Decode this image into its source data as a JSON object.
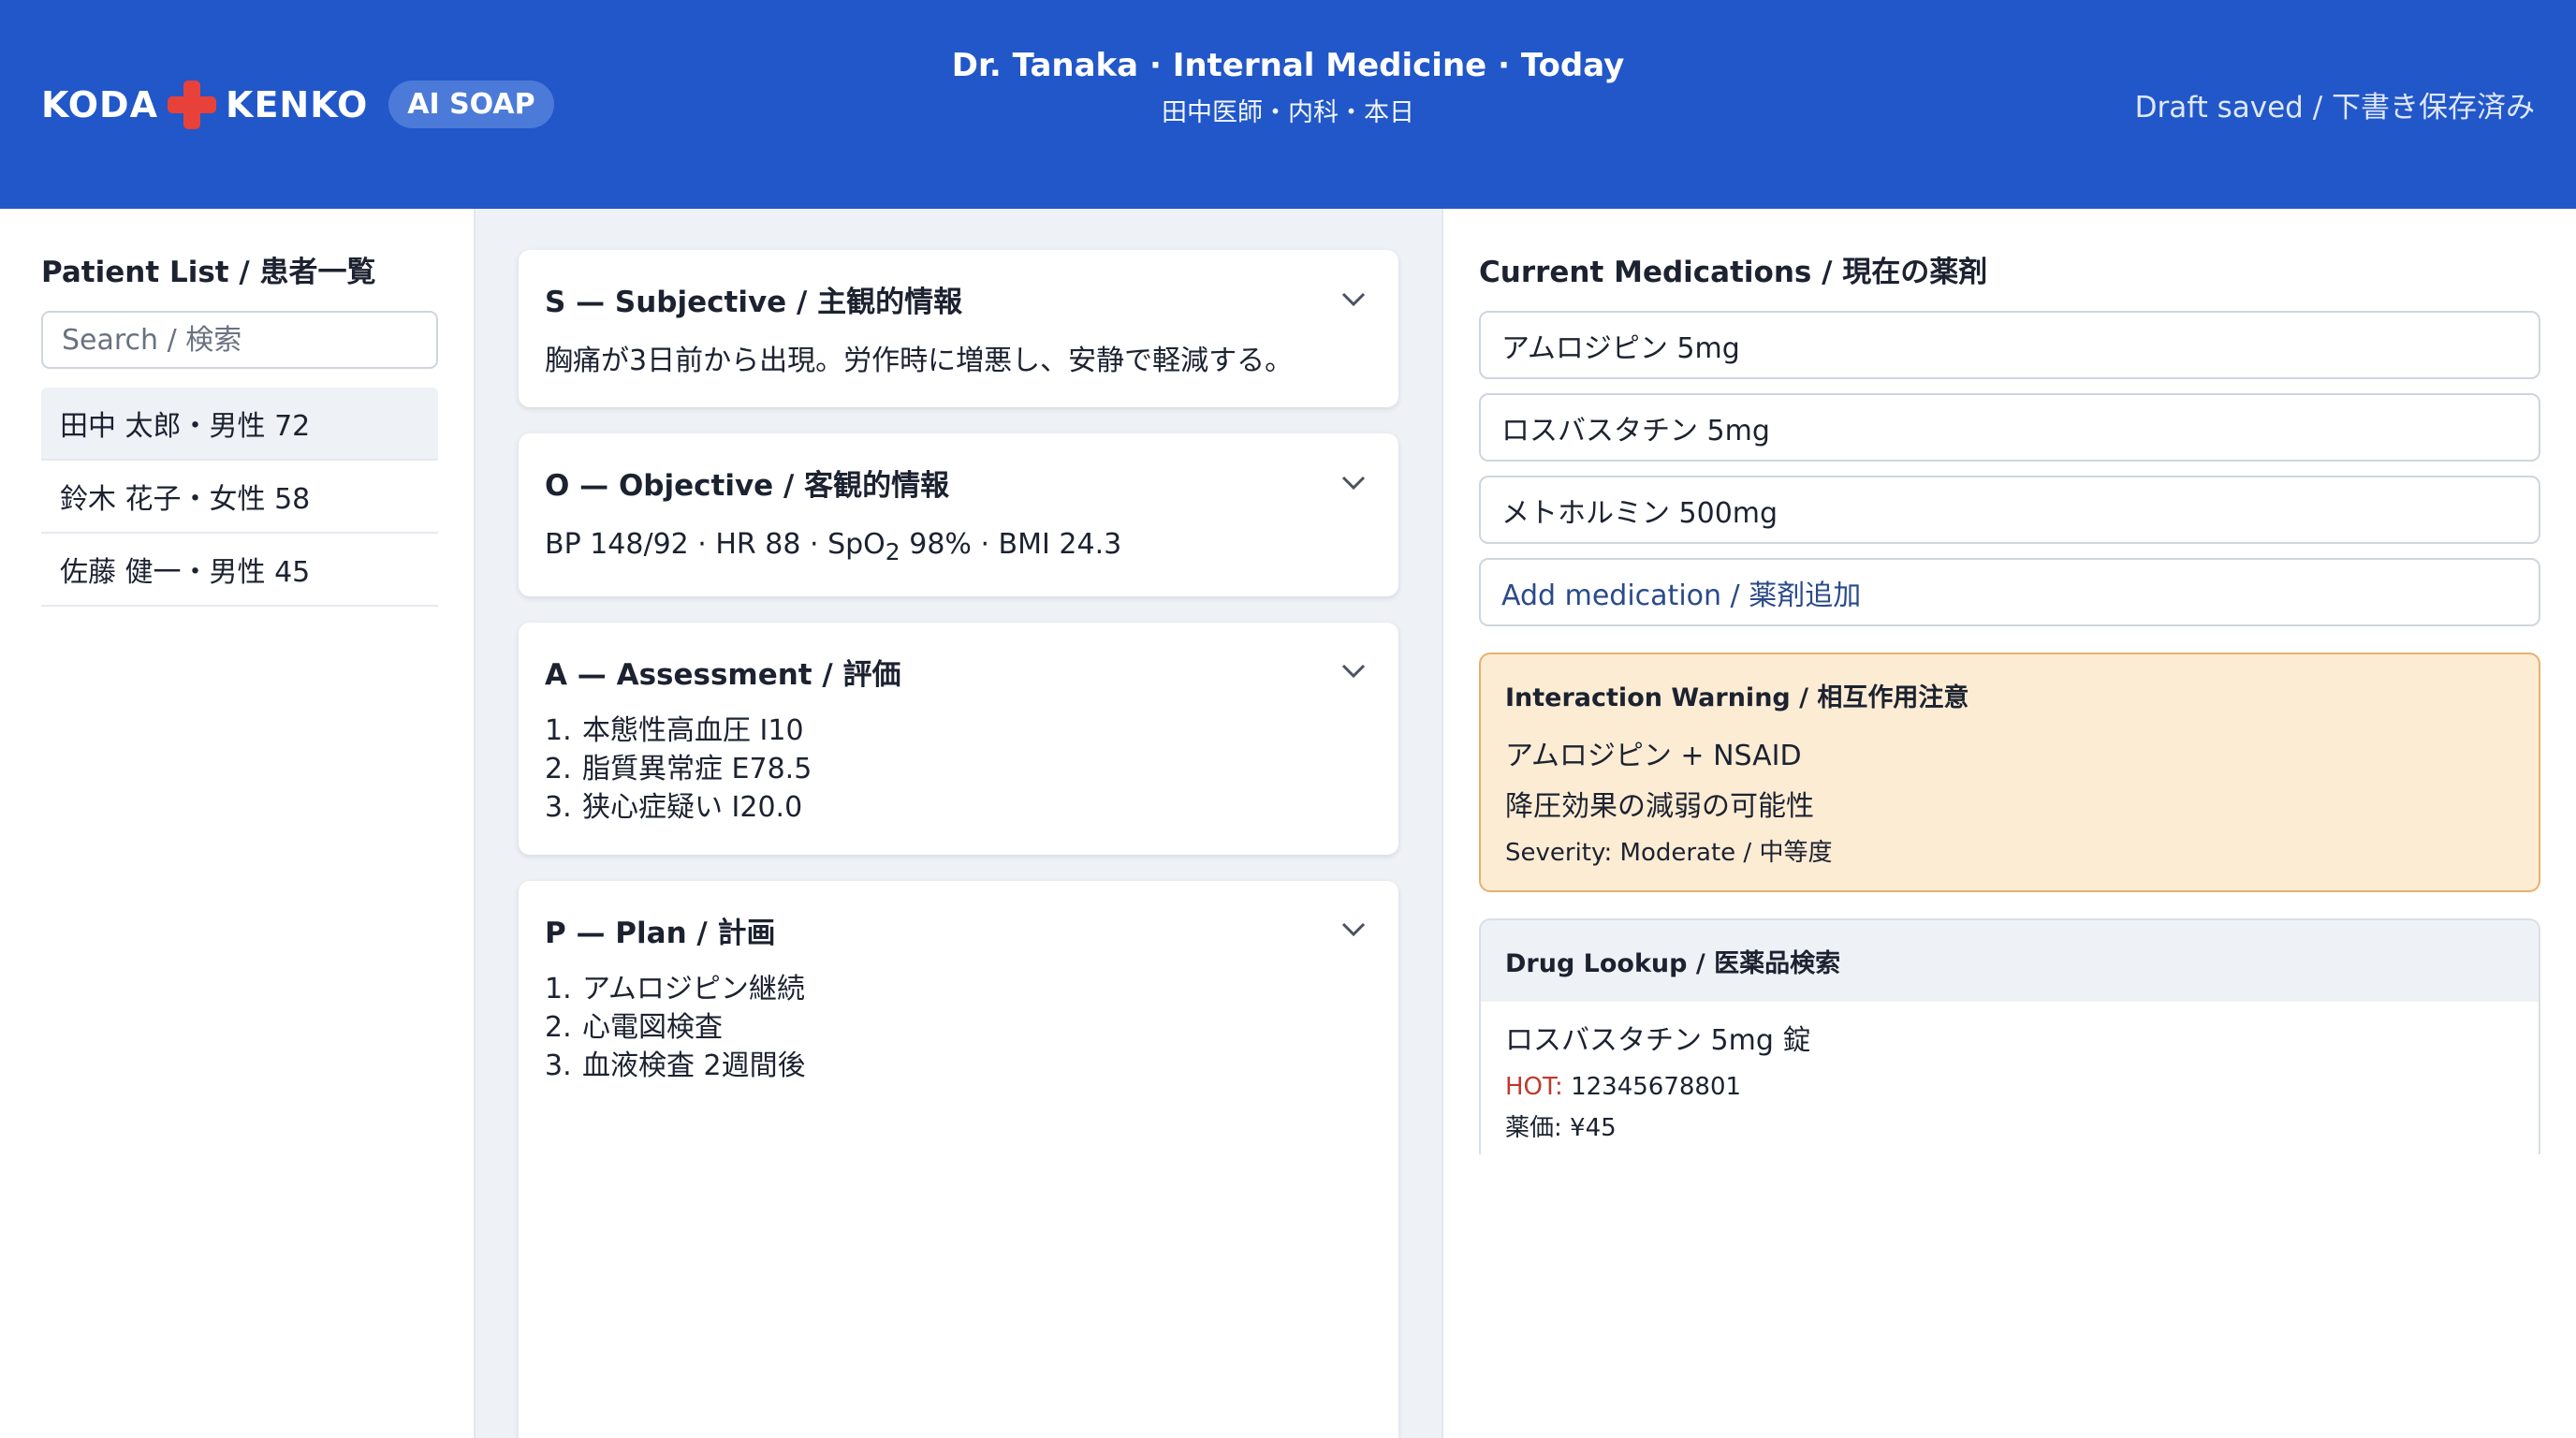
{
  "header": {
    "brand_left": "KODA",
    "brand_right": "KENKO",
    "product_pill": "AI SOAP",
    "context_line_en": "Dr. Tanaka · Internal Medicine · Today",
    "context_line_ja": "田中医師・内科・本日",
    "save_status": "Draft saved / 下書き保存済み",
    "colors": {
      "bar": "#2157c8",
      "logo_cross": "#e8413a"
    }
  },
  "patients": {
    "title": "Patient List / 患者一覧",
    "search_placeholder": "Search / 検索",
    "items": [
      {
        "label": "田中 太郎・男性 72",
        "selected": true
      },
      {
        "label": "鈴木 花子・女性 58",
        "selected": false
      },
      {
        "label": "佐藤 健一・男性 45",
        "selected": false
      }
    ]
  },
  "soap": {
    "subjective": {
      "title": "S — Subjective / 主観的情報",
      "text": "胸痛が3日前から出現。労作時に増悪し、安静で軽減する。"
    },
    "objective": {
      "title": "O — Objective / 客観的情報",
      "bp": "BP 148/92",
      "hr": "HR 88",
      "spo2_label": "SpO",
      "spo2_sub": "2",
      "spo2_value": "98%",
      "bmi": "BMI 24.3"
    },
    "assessment": {
      "title": "A — Assessment / 評価",
      "items": [
        "本態性高血圧 I10",
        "脂質異常症 E78.5",
        "狭心症疑い I20.0"
      ]
    },
    "plan": {
      "title": "P — Plan / 計画",
      "items": [
        "アムロジピン継続",
        "心電図検査",
        "血液検査 2週間後"
      ]
    }
  },
  "medications": {
    "title": "Current Medications / 現在の薬剤",
    "items": [
      "アムロジピン 5mg",
      "ロスバスタチン 5mg",
      "メトホルミン 500mg"
    ],
    "add_label": "Add medication / 薬剤追加"
  },
  "interaction_warning": {
    "title": "Interaction Warning / 相互作用注意",
    "pair": "アムロジピン + NSAID",
    "effect": "降圧効果の減弱の可能性",
    "severity": "Severity: Moderate / 中等度",
    "colors": {
      "background": "#fdecd4",
      "border": "#e8b06e"
    }
  },
  "drug_lookup": {
    "title": "Drug Lookup / 医薬品検索",
    "drug_name": "ロスバスタチン 5mg 錠",
    "hot_label": "HOT:",
    "hot_code": "12345678801",
    "price": "薬価: ¥45"
  }
}
